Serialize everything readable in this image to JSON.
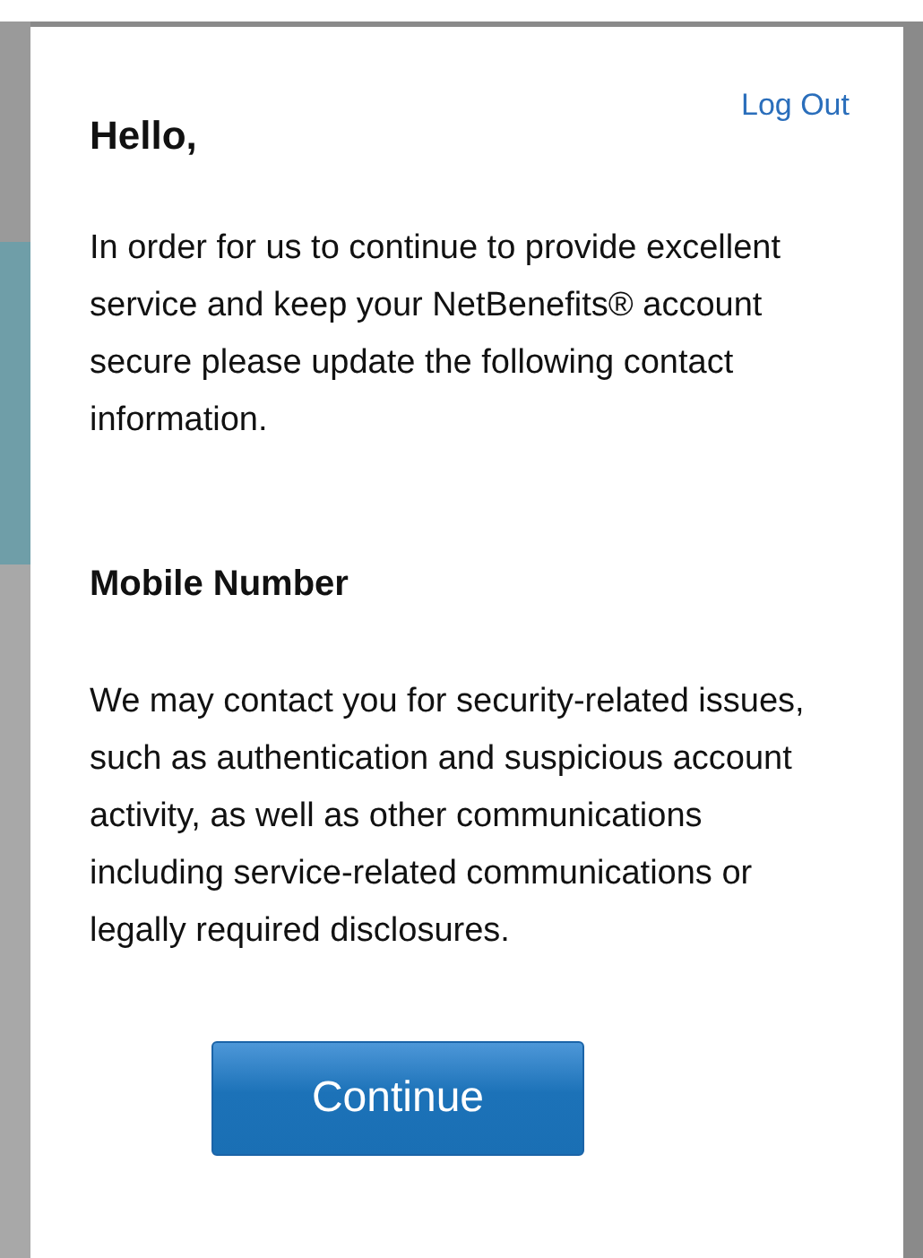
{
  "dialog": {
    "title": "Hello,",
    "logout_link": "Log Out",
    "intro": "In order for us to continue to provide excellent service and keep your NetBenefits® account secure please update the following contact information.",
    "section_title": "Mobile Number",
    "section_text": "We may contact you for security-related issues, such as authentication and suspicious account activity, as well as other communications including service-related communications or legally required disclosures.",
    "buttons": [
      "Continue"
    ]
  }
}
